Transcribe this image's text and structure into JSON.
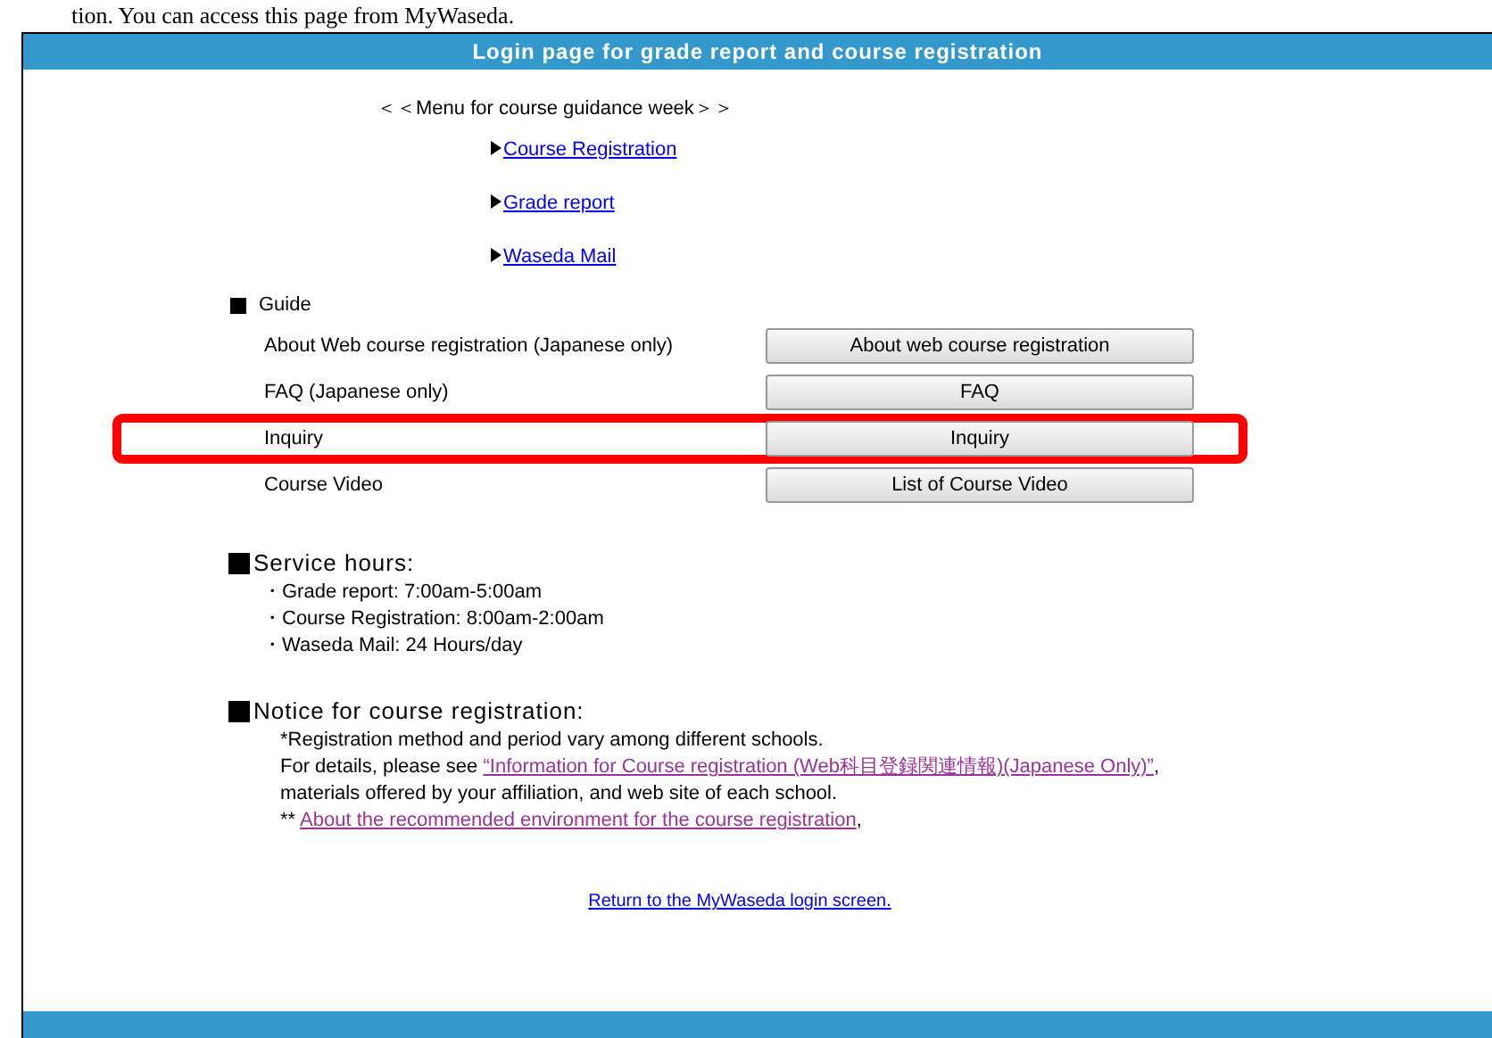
{
  "document_text": "tion. You can access this page from MyWaseda.",
  "header": {
    "title": "Login page for grade report and course registration"
  },
  "menu": {
    "heading": "＜＜Menu for course guidance week＞＞",
    "links": [
      {
        "label": "Course Registration",
        "visited": false
      },
      {
        "label": "Grade report",
        "visited": false
      },
      {
        "label": "Waseda Mail",
        "visited": false
      }
    ]
  },
  "guide": {
    "heading": "Guide",
    "rows": [
      {
        "label": "About Web course registration (Japanese only)",
        "button": "About web course registration",
        "highlighted": false
      },
      {
        "label": "FAQ (Japanese only)",
        "button": "FAQ",
        "highlighted": false
      },
      {
        "label": "Inquiry",
        "button": "Inquiry",
        "highlighted": true
      },
      {
        "label": "Course Video",
        "button": "List of Course Video",
        "highlighted": false
      }
    ]
  },
  "service_hours": {
    "heading": "Service hours:",
    "items": [
      "・Grade report: 7:00am-5:00am",
      "・Course Registration: 8:00am-2:00am",
      "・Waseda Mail: 24 Hours/day"
    ]
  },
  "notice": {
    "heading": "Notice for course registration:",
    "lines": [
      {
        "parts": [
          {
            "kind": "text",
            "text": "*Registration method and period vary among different schools."
          }
        ]
      },
      {
        "parts": [
          {
            "kind": "text",
            "text": "For details, please see "
          },
          {
            "kind": "link",
            "text": "“Information for Course registration (Web科目登録関連情報)(Japanese Only)”",
            "visited": true
          },
          {
            "kind": "text",
            "text": ","
          }
        ]
      },
      {
        "parts": [
          {
            "kind": "text",
            "text": "materials offered by your affiliation, and web site of each school."
          }
        ]
      },
      {
        "parts": [
          {
            "kind": "text",
            "text": "** "
          },
          {
            "kind": "link",
            "text": "About the recommended environment for the course registration",
            "visited": true
          },
          {
            "kind": "text",
            "text": ","
          }
        ]
      }
    ]
  },
  "footer_link": {
    "label": "Return to the MyWaseda login screen.",
    "visited": false
  }
}
